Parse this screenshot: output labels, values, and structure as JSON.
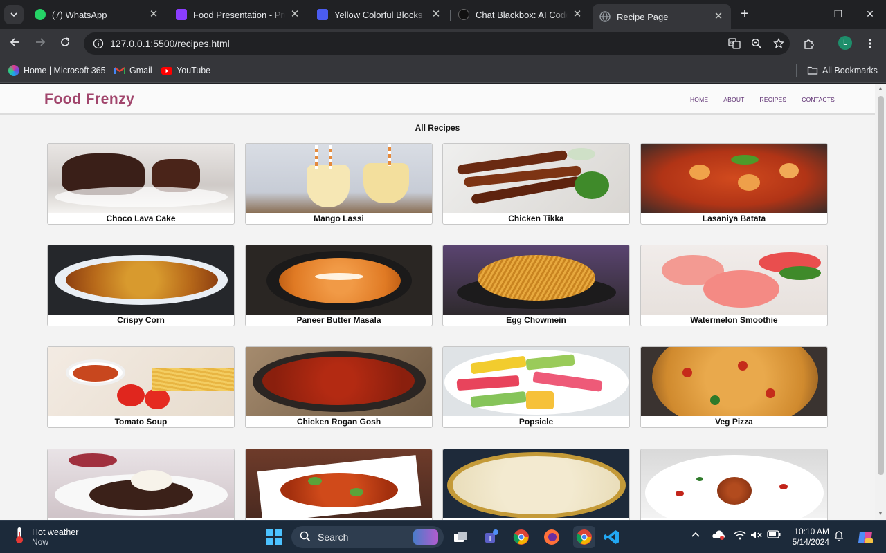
{
  "browser": {
    "tabs": [
      {
        "title": "(7) WhatsApp",
        "favicon": "whatsapp-icon",
        "color": "#25d366"
      },
      {
        "title": "Food Presentation - Presentation",
        "favicon": "canva-icon",
        "color": "#8b3dff"
      },
      {
        "title": "Yellow Colorful Blocks For",
        "favicon": "canva-icon",
        "color": "#4b5cf0"
      },
      {
        "title": "Chat Blackbox: AI Code C",
        "favicon": "blackbox-icon",
        "color": "#111111"
      },
      {
        "title": "Recipe Page",
        "favicon": "globe-icon",
        "color": "#9aa0a6",
        "active": true
      }
    ],
    "url": "127.0.0.1:5500/recipes.html",
    "profile_initial": "L",
    "bookmarks": [
      {
        "label": "Home | Microsoft 365"
      },
      {
        "label": "Gmail"
      },
      {
        "label": "YouTube"
      }
    ],
    "all_bookmarks": "All Bookmarks"
  },
  "site": {
    "logo": "Food Frenzy",
    "nav": [
      "HOME",
      "ABOUT",
      "RECIPES",
      "CONTACTS"
    ],
    "section_title": "All Recipes",
    "recipes": [
      {
        "name": "Choco Lava Cake"
      },
      {
        "name": "Mango Lassi"
      },
      {
        "name": "Chicken Tikka"
      },
      {
        "name": "Lasaniya Batata"
      },
      {
        "name": "Crispy Corn"
      },
      {
        "name": "Paneer Butter Masala"
      },
      {
        "name": "Egg Chowmein"
      },
      {
        "name": "Watermelon Smoothie"
      },
      {
        "name": "Tomato Soup"
      },
      {
        "name": "Chicken Rogan Gosh"
      },
      {
        "name": "Popsicle"
      },
      {
        "name": "Veg Pizza"
      },
      {
        "name": ""
      },
      {
        "name": ""
      },
      {
        "name": ""
      },
      {
        "name": ""
      }
    ]
  },
  "taskbar": {
    "weather_title": "Hot weather",
    "weather_sub": "Now",
    "search_placeholder": "Search",
    "time": "10:10 AM",
    "date": "5/14/2024"
  }
}
